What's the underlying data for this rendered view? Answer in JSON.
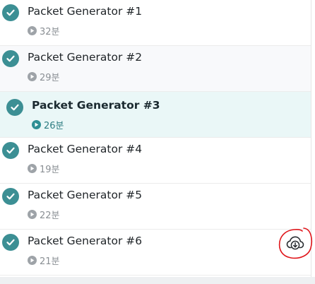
{
  "lectures": [
    {
      "title": "Packet Generator #1",
      "duration": "32분"
    },
    {
      "title": "Packet Generator #2",
      "duration": "29분"
    },
    {
      "title": "Packet Generator #3",
      "duration": "26분"
    },
    {
      "title": "Packet Generator #4",
      "duration": "19분"
    },
    {
      "title": "Packet Generator #5",
      "duration": "22분"
    },
    {
      "title": "Packet Generator #6",
      "duration": "21분"
    }
  ],
  "active_index": 2,
  "colors": {
    "check": "#3c8f94",
    "active_background": "#eaf7f7",
    "annotation": "#e0161b"
  },
  "icons": {
    "completed": "check-circle-icon",
    "duration": "play-circle-icon",
    "download": "cloud-download-icon"
  }
}
